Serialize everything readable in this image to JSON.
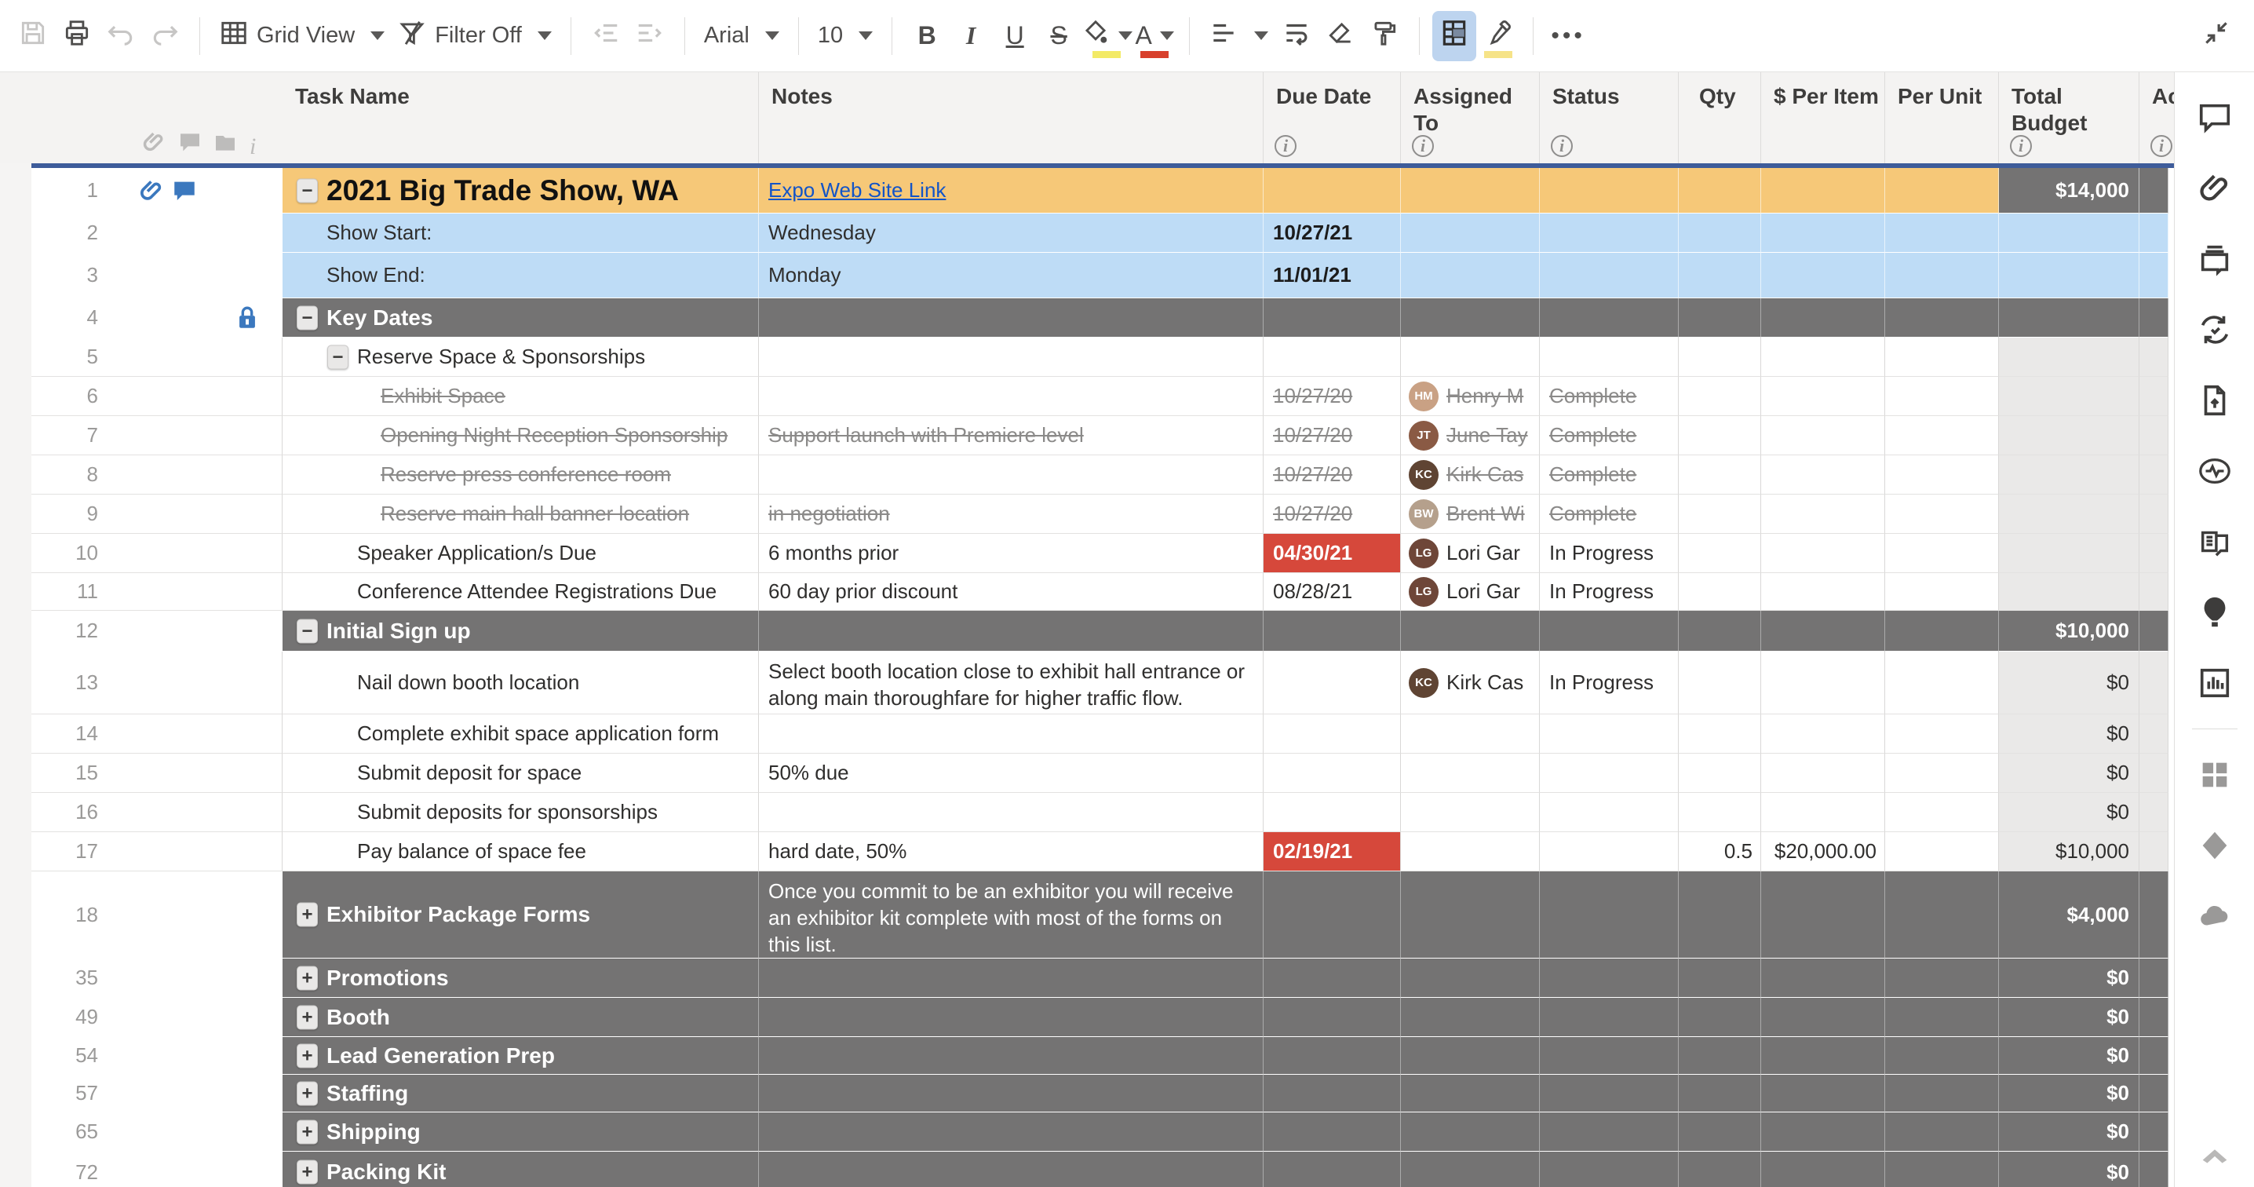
{
  "toolbar": {
    "grid_view": "Grid View",
    "filter": "Filter Off",
    "font": "Arial",
    "font_size": "10",
    "bold": "B",
    "italic": "I",
    "underline": "U",
    "strikethrough": "S",
    "font_color_letter": "A",
    "more": "•••",
    "fill_swatch": "#F3EA66",
    "font_color_swatch": "#D8402C",
    "highlight_swatch": "#F6E388"
  },
  "sheet": {
    "columns": [
      {
        "label": "Task Name",
        "info": false
      },
      {
        "label": "Notes",
        "info": false
      },
      {
        "label": "Due Date",
        "info": true
      },
      {
        "label": "Assigned To",
        "info": true
      },
      {
        "label": "Status",
        "info": true
      },
      {
        "label": "Qty",
        "info": false
      },
      {
        "label": "$ Per Item",
        "info": false
      },
      {
        "label": "Per Unit",
        "info": false
      },
      {
        "label": "Total Budget",
        "info": true
      },
      {
        "label": "Ac",
        "info": true
      }
    ],
    "rows": [
      {
        "num": "1",
        "h": 58,
        "bg": "tan",
        "level": 1,
        "box": "minus",
        "icons": [
          "attachment",
          "comment"
        ],
        "task": "2021 Big Trade Show, WA",
        "task_style": "title",
        "notes": "Expo Web Site Link",
        "notes_style": "link",
        "budget": "$14,000",
        "budget_style": "dark"
      },
      {
        "num": "2",
        "h": 50,
        "bg": "blue",
        "level": 1,
        "task": "Show Start:",
        "notes": "Wednesday",
        "due": "10/27/21",
        "due_style": "bold"
      },
      {
        "num": "3",
        "h": 58,
        "bg": "blue",
        "level": 1,
        "task": "Show End:",
        "notes": "Monday",
        "due": "11/01/21",
        "due_style": "bold"
      },
      {
        "num": "4",
        "h": 50,
        "bg": "dark",
        "level": 1,
        "box": "minus",
        "icons": [
          "lock"
        ],
        "task": "Key Dates",
        "task_style": "section"
      },
      {
        "num": "5",
        "h": 50,
        "bg": "white",
        "level": 2,
        "box": "minus",
        "task": "Reserve Space & Sponsorships"
      },
      {
        "num": "6",
        "h": 50,
        "bg": "white",
        "level": 3,
        "task": "Exhibit Space",
        "task_style": "strike",
        "due": "10/27/20",
        "due_style": "strike",
        "who": "Henry M",
        "who_init": "HM",
        "who_color": "#C9A184",
        "who_strike": true,
        "status": "Complete",
        "status_style": "strike"
      },
      {
        "num": "7",
        "h": 50,
        "bg": "white",
        "level": 3,
        "task": "Opening Night Reception Sponsorship",
        "task_style": "strike",
        "notes": "Support launch with Premiere level",
        "notes_style": "strike",
        "due": "10/27/20",
        "due_style": "strike",
        "who": "June Tay",
        "who_init": "JT",
        "who_color": "#8A5A44",
        "who_strike": true,
        "status": "Complete",
        "status_style": "strike"
      },
      {
        "num": "8",
        "h": 50,
        "bg": "white",
        "level": 3,
        "task": "Reserve press conference room",
        "task_style": "strike",
        "due": "10/27/20",
        "due_style": "strike",
        "who": "Kirk Cas",
        "who_init": "KC",
        "who_color": "#5F4433",
        "who_strike": true,
        "status": "Complete",
        "status_style": "strike"
      },
      {
        "num": "9",
        "h": 50,
        "bg": "white",
        "level": 3,
        "task": "Reserve main hall banner location",
        "task_style": "strike",
        "notes": "in negotiation",
        "notes_style": "strike",
        "due": "10/27/20",
        "due_style": "strike",
        "who": "Brent Wi",
        "who_init": "BW",
        "who_color": "#B5A08C",
        "who_strike": true,
        "status": "Complete",
        "status_style": "strike"
      },
      {
        "num": "10",
        "h": 50,
        "bg": "white",
        "level": 2,
        "task": "Speaker Application/s Due",
        "notes": "6 months prior",
        "due": "04/30/21",
        "due_style": "red",
        "who": "Lori Gar",
        "who_init": "LG",
        "who_color": "#6E4638",
        "status": "In Progress"
      },
      {
        "num": "11",
        "h": 48,
        "bg": "white",
        "level": 2,
        "task": "Conference Attendee Registrations Due",
        "notes": "60 day prior discount",
        "due": "08/28/21",
        "who": "Lori Gar",
        "who_init": "LG",
        "who_color": "#6E4638",
        "status": "In Progress"
      },
      {
        "num": "12",
        "h": 52,
        "bg": "dark",
        "level": 1,
        "box": "minus",
        "task": "Initial Sign up",
        "task_style": "section",
        "budget": "$10,000",
        "budget_style": "dark"
      },
      {
        "num": "13",
        "h": 80,
        "bg": "white",
        "level": 2,
        "task": "Nail down booth location",
        "notes": "Select booth location close to exhibit hall entrance or along main thoroughfare for higher traffic flow.",
        "notes_wrap": true,
        "who": "Kirk Cas",
        "who_init": "KC",
        "who_color": "#5F4433",
        "status": "In Progress",
        "budget": "$0"
      },
      {
        "num": "14",
        "h": 50,
        "bg": "white",
        "level": 2,
        "task": "Complete exhibit space application form",
        "budget": "$0"
      },
      {
        "num": "15",
        "h": 50,
        "bg": "white",
        "level": 2,
        "task": "Submit deposit for space",
        "notes": "50% due",
        "budget": "$0"
      },
      {
        "num": "16",
        "h": 50,
        "bg": "white",
        "level": 2,
        "task": "Submit deposits for sponsorships",
        "budget": "$0"
      },
      {
        "num": "17",
        "h": 50,
        "bg": "white",
        "level": 2,
        "task": "Pay balance of space fee",
        "notes": "hard date, 50%",
        "due": "02/19/21",
        "due_style": "red",
        "qty": "0.5",
        "per_item": "$20,000.00",
        "budget": "$10,000"
      },
      {
        "num": "18",
        "h": 111,
        "bg": "dark",
        "level": 1,
        "box": "plus",
        "task": "Exhibitor Package Forms",
        "task_style": "section",
        "notes": "Once you commit to be an exhibitor you will receive an exhibitor kit complete with most of the forms on this list.",
        "notes_style": "white",
        "notes_wrap": true,
        "budget": "$4,000",
        "budget_style": "dark"
      },
      {
        "num": "35",
        "h": 50,
        "bg": "dark",
        "level": 1,
        "box": "plus",
        "task": "Promotions",
        "task_style": "section",
        "budget": "$0",
        "budget_style": "dark"
      },
      {
        "num": "49",
        "h": 50,
        "bg": "dark",
        "level": 1,
        "box": "plus",
        "task": "Booth",
        "task_style": "section",
        "budget": "$0",
        "budget_style": "dark"
      },
      {
        "num": "54",
        "h": 48,
        "bg": "dark",
        "level": 1,
        "box": "plus",
        "task": "Lead Generation Prep",
        "task_style": "section",
        "budget": "$0",
        "budget_style": "dark"
      },
      {
        "num": "57",
        "h": 48,
        "bg": "dark",
        "level": 1,
        "box": "plus",
        "task": "Staffing",
        "task_style": "section",
        "budget": "$0",
        "budget_style": "dark"
      },
      {
        "num": "65",
        "h": 50,
        "bg": "dark",
        "level": 1,
        "box": "plus",
        "task": "Shipping",
        "task_style": "section",
        "budget": "$0",
        "budget_style": "dark"
      },
      {
        "num": "72",
        "h": 53,
        "bg": "dark",
        "level": 1,
        "box": "plus",
        "task": "Packing Kit",
        "task_style": "section",
        "budget": "$0",
        "budget_style": "dark"
      }
    ]
  },
  "sidebar_icons": [
    "comment",
    "link",
    "print-card",
    "sync-check",
    "file-upload",
    "activity",
    "card-list",
    "balloon",
    "bar-chart",
    "divider",
    "grid-squares",
    "diamond",
    "cloud"
  ],
  "colors": {
    "accent_navy": "#3E5C9A",
    "row_tan": "#F6C878",
    "row_blue": "#BEDCF6",
    "section_gray": "#747373",
    "late_red": "#D6483B",
    "budget_col_gray": "#EAE9E8",
    "link_blue": "#1254C8",
    "selected_button_blue": "#BDD4EF"
  }
}
